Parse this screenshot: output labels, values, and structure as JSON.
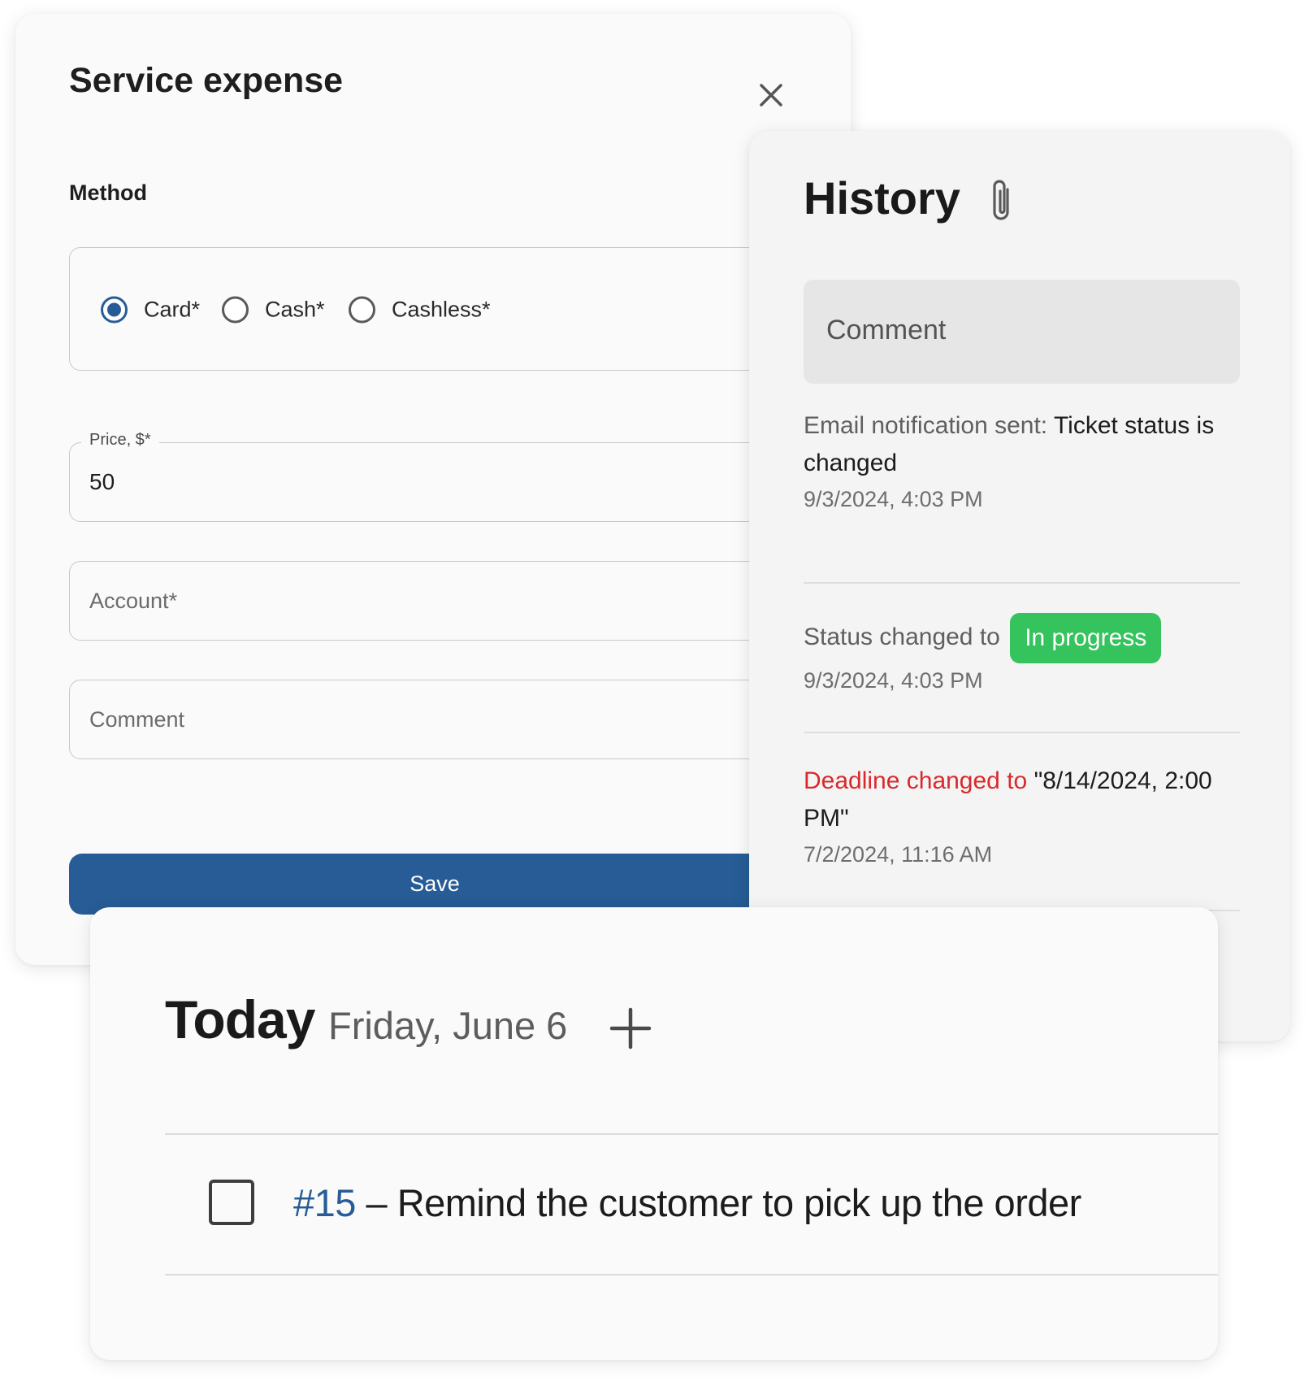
{
  "service_expense": {
    "title": "Service expense",
    "method_label": "Method",
    "methods": [
      {
        "label": "Card",
        "required_mark": "*",
        "selected": true
      },
      {
        "label": "Cash",
        "required_mark": "*",
        "selected": false
      },
      {
        "label": "Cashless",
        "required_mark": "*",
        "selected": false
      }
    ],
    "price": {
      "label": "Price, $",
      "required_mark": "*",
      "value": "50"
    },
    "account": {
      "placeholder": "Account",
      "required_mark": "*"
    },
    "comment": {
      "placeholder": "Comment"
    },
    "save_label": "Save"
  },
  "history": {
    "title": "History",
    "comment_placeholder": "Comment",
    "entries": [
      {
        "prefix": "Email notification sent:",
        "text": "Ticket status is changed",
        "time": "9/3/2024, 4:03 PM"
      },
      {
        "prefix": "Status changed to",
        "badge": "In progress",
        "time": "9/3/2024, 4:03 PM"
      },
      {
        "prefix": "Deadline changed to",
        "text": "\"8/14/2024, 2:00 PM\"",
        "time": "7/2/2024, 11:16 AM"
      }
    ]
  },
  "today": {
    "title": "Today",
    "date": "Friday, June 6",
    "task": {
      "id": "#15",
      "separator": "–",
      "text": "Remind the customer to pick up the order",
      "checked": false
    }
  },
  "colors": {
    "primary": "#275c96",
    "status_in_progress": "#34c35c",
    "deadline_red": "#d9292b"
  },
  "icons": [
    "close-icon",
    "paperclip-icon",
    "plus-icon"
  ]
}
